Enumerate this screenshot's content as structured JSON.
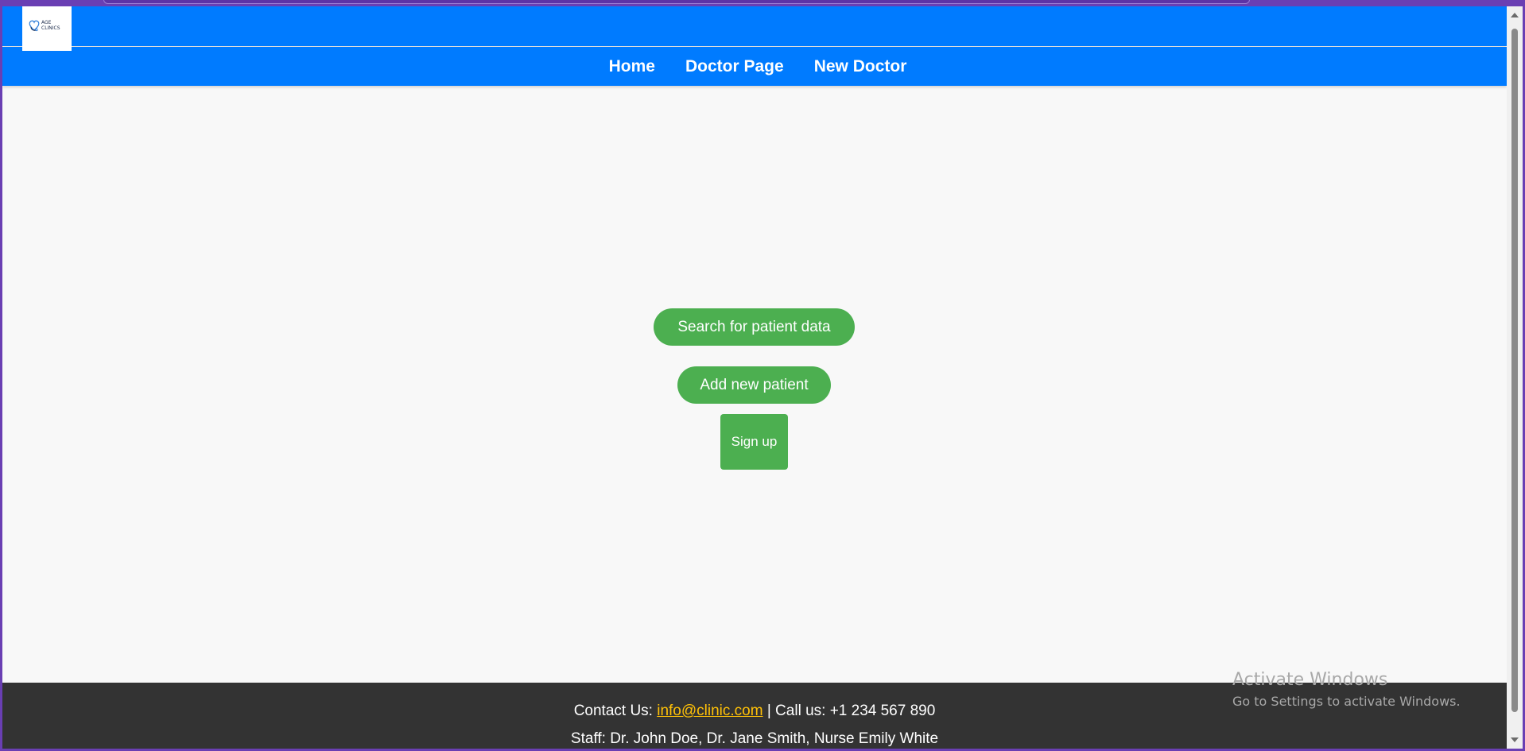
{
  "header": {
    "logo_text_line1": "AGE",
    "logo_text_line2": "CLINICS"
  },
  "nav": {
    "items": [
      {
        "label": "Home"
      },
      {
        "label": "Doctor Page"
      },
      {
        "label": "New Doctor"
      }
    ]
  },
  "main": {
    "search_button_label": "Search for patient data",
    "add_patient_button_label": "Add new patient",
    "signup_button_label": "Sign up"
  },
  "footer": {
    "contact_prefix": "Contact Us:",
    "email": "info@clinic.com",
    "phone_text": "| Call us: +1 234 567 890",
    "staff_text": "Staff: Dr. John Doe, Dr. Jane Smith, Nurse Emily White"
  },
  "watermark": {
    "title": "Activate Windows",
    "subtitle": "Go to Settings to activate Windows."
  },
  "colors": {
    "nav_blue": "#007bff",
    "button_green": "#4caf50",
    "footer_bg": "#333333",
    "link_yellow": "#ffc107",
    "window_frame": "#6a3fb3"
  },
  "icons": {
    "logo": "heart-stethoscope-icon"
  }
}
